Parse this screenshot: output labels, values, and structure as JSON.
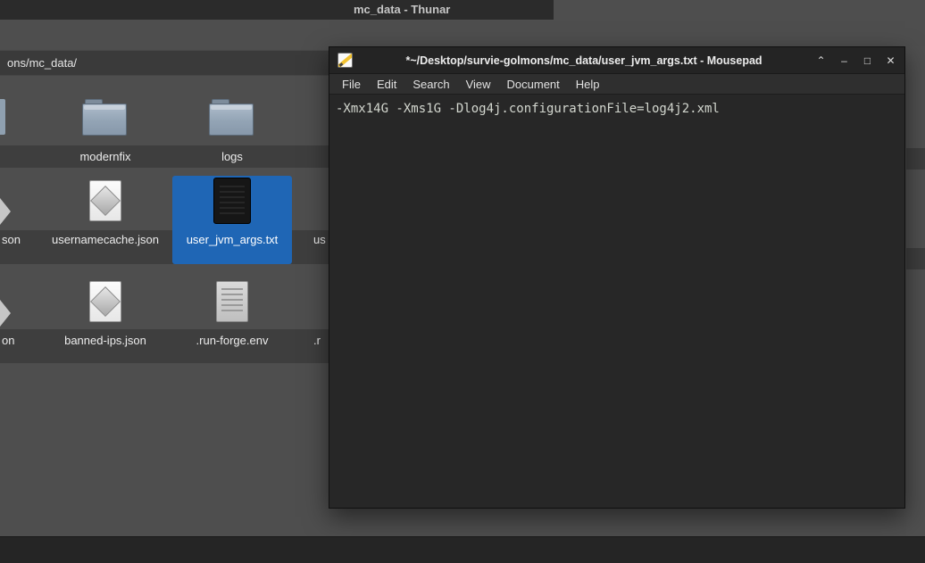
{
  "colors": {
    "desktop_gray": "#4e4e4e",
    "band_gray": "#3e3e3e",
    "selection_blue": "#1f66b5",
    "thunar_titlebar": "#2b2b2b",
    "panel_dark": "#252525",
    "mousepad_titlebar": "#242424",
    "mousepad_menubar": "#2f2f2f",
    "mousepad_editor": "#272727"
  },
  "thunar": {
    "window_title": "mc_data - Thunar",
    "path_bar_text": "ons/mc_data/",
    "items": [
      {
        "label": "modernfix",
        "type": "folder",
        "selected": false
      },
      {
        "label": "logs",
        "type": "folder",
        "selected": false
      },
      {
        "label": "usernamecache.json",
        "type": "json-file",
        "selected": false
      },
      {
        "label": "user_jvm_args.txt",
        "type": "text-file",
        "selected": true
      },
      {
        "label": "banned-ips.json",
        "type": "json-file",
        "selected": false
      },
      {
        "label": ".run-forge.env",
        "type": "config-file",
        "selected": false
      }
    ],
    "clipped_items": [
      {
        "label": "son",
        "edge": "left"
      },
      {
        "label": "on",
        "edge": "left"
      },
      {
        "label": "us",
        "edge": "right"
      },
      {
        "label": ".r",
        "edge": "right"
      }
    ]
  },
  "mousepad": {
    "window_title": "*~/Desktop/survie-golmons/mc_data/user_jvm_args.txt - Mousepad",
    "menu_items": [
      "File",
      "Edit",
      "Search",
      "View",
      "Document",
      "Help"
    ],
    "editor_text": "-Xmx14G -Xms1G -Dlog4j.configurationFile=log4j2.xml",
    "window_controls": {
      "shade": "⌃",
      "minimize": "–",
      "maximize": "□",
      "close": "✕"
    }
  }
}
